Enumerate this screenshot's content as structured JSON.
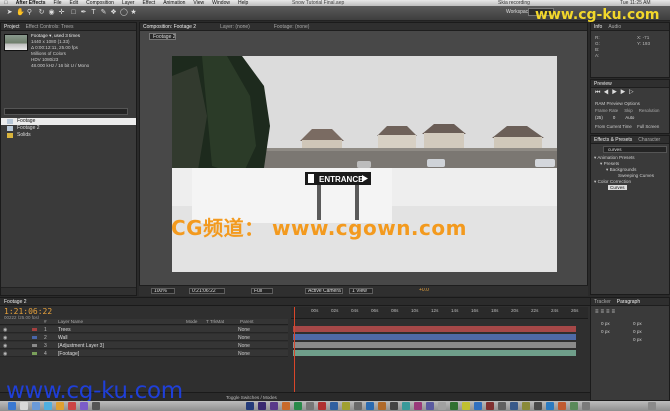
{
  "menubar": {
    "apple": "",
    "app": "After Effects",
    "items": [
      "File",
      "Edit",
      "Composition",
      "Layer",
      "Effect",
      "Animation",
      "View",
      "Window",
      "Help"
    ],
    "window_title": "Snow Tutorial Final.aep",
    "recording": "Skia recording",
    "clock": "Tue 11:25 AM"
  },
  "toolbar": {
    "workspace_label": "Workspace:"
  },
  "project": {
    "tabs": [
      "Project",
      "Effect Controls: Trees"
    ],
    "footage_name": "Footage ▾, used 3 times",
    "info": [
      "1440 x 1080 (1.33)",
      "Δ 0:00:12:11, 25.00 fps",
      "Millions of Colors",
      "HDV 1080i23",
      "48.000 kHz / 16 bit U / Mono"
    ],
    "items": [
      {
        "name": "Footage",
        "selected": true,
        "color": "#b8c8d8"
      },
      {
        "name": "Footage 2",
        "selected": false,
        "color": "#b8c8d8"
      },
      {
        "name": "Solids",
        "selected": false,
        "color": "#d9b43c"
      }
    ]
  },
  "comp": {
    "tabs": [
      "Composition: Footage 2",
      "Layer: (none)",
      "Footage: (none)"
    ],
    "button": "Footage 2",
    "sign_text": "ENTRANCE",
    "zoom": "100%",
    "timecode": "0:21:06:22",
    "resolution": "Full",
    "camera": "Active Camera",
    "view": "1 View",
    "exposure": "+0.0"
  },
  "watermarks": {
    "center": "CG频道： www.cgown.com",
    "bottom": "www.cg-ku.com",
    "top": "www.cg-ku.com"
  },
  "right": {
    "info_tabs": [
      "Info",
      "Audio"
    ],
    "info_r": "R:",
    "info_g": "G:",
    "info_b": "B:",
    "info_a": "A:",
    "info_x": "X: -71",
    "info_y": "Y: 193",
    "preview_tab": "Preview",
    "ram_options": "RAM Preview Options",
    "frame_rate_label": "Frame Rate",
    "skip_label": "Skip",
    "resolution_label": "Resolution",
    "frame_rate": "(25)",
    "skip": "0",
    "resolution": "Auto",
    "from_current": "From Current Time",
    "full_screen": "Full Screen",
    "effects_tabs": [
      "Effects & Presets",
      "Character"
    ],
    "search": "curves",
    "tree": [
      "▾ Animation Presets",
      "▾ Presets",
      "▾ Backgrounds",
      "Sweeping Curves",
      "▾ Color Correction",
      "Curves"
    ],
    "tracker_tabs": [
      "Tracker",
      "Paragraph"
    ],
    "para_values": [
      "0 px",
      "0 px",
      "0 px",
      "0 px",
      "0 px"
    ]
  },
  "timeline": {
    "tab": "Footage 2",
    "timecode": "1:21:06:22",
    "sub": "00222 (25.00 fps)",
    "columns": [
      "#",
      "Layer Name",
      "Mode",
      "T TrkMat",
      "Parent"
    ],
    "layers": [
      {
        "num": "1",
        "name": "Trees",
        "mode": "None",
        "color": "#a54040"
      },
      {
        "num": "2",
        "name": "Wall",
        "mode": "None",
        "color": "#4a66a8"
      },
      {
        "num": "3",
        "name": "[Adjustment Layer 3]",
        "mode": "None",
        "color": "#8a8a8a"
      },
      {
        "num": "4",
        "name": "[Footage]",
        "mode": "None",
        "color": "#7aa05a"
      }
    ],
    "ticks": [
      "00s",
      "02s",
      "04s",
      "06s",
      "08s",
      "10s",
      "12s",
      "14s",
      "16s",
      "18s",
      "20s",
      "22s",
      "24s",
      "26s"
    ],
    "toggle": "Toggle Switches / Modes"
  }
}
